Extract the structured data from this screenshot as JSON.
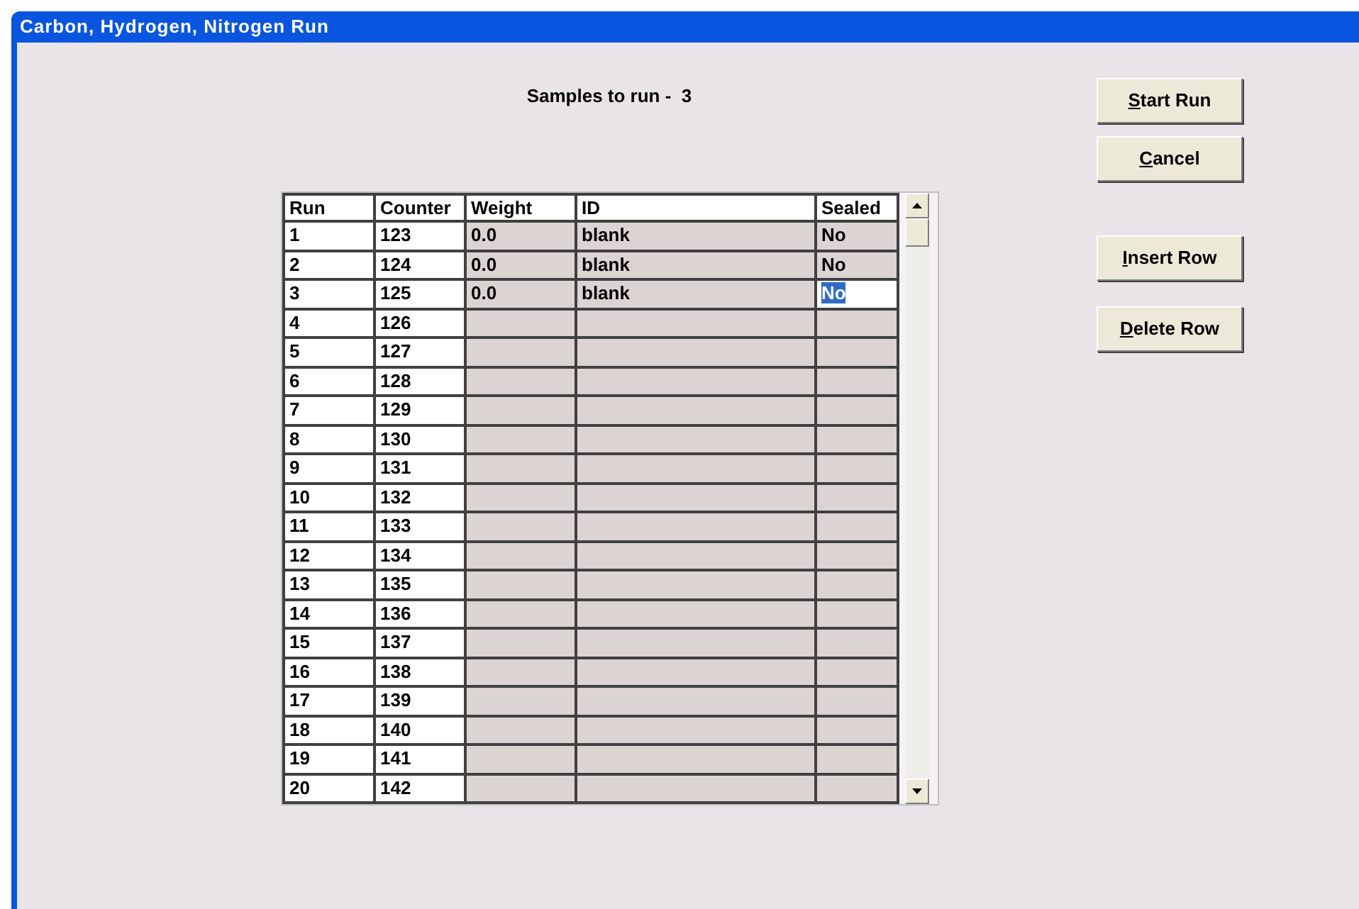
{
  "window": {
    "title": "Carbon, Hydrogen, Nitrogen Run"
  },
  "summary": "Samples to run -  3",
  "table": {
    "columns": [
      "Run",
      "Counter",
      "Weight",
      "ID",
      "Sealed"
    ],
    "rows": [
      {
        "run": "1",
        "counter": "123",
        "weight": "0.0",
        "id": "blank",
        "sealed": "No",
        "editing": false
      },
      {
        "run": "2",
        "counter": "124",
        "weight": "0.0",
        "id": "blank",
        "sealed": "No",
        "editing": false
      },
      {
        "run": "3",
        "counter": "125",
        "weight": "0.0",
        "id": "blank",
        "sealed": "No",
        "editing": true
      },
      {
        "run": "4",
        "counter": "126",
        "editing": false
      },
      {
        "run": "5",
        "counter": "127",
        "editing": false
      },
      {
        "run": "6",
        "counter": "128",
        "editing": false
      },
      {
        "run": "7",
        "counter": "129",
        "editing": false
      },
      {
        "run": "8",
        "counter": "130",
        "editing": false
      },
      {
        "run": "9",
        "counter": "131",
        "editing": false
      },
      {
        "run": "10",
        "counter": "132",
        "editing": false
      },
      {
        "run": "11",
        "counter": "133",
        "editing": false
      },
      {
        "run": "12",
        "counter": "134",
        "editing": false
      },
      {
        "run": "13",
        "counter": "135",
        "editing": false
      },
      {
        "run": "14",
        "counter": "136",
        "editing": false
      },
      {
        "run": "15",
        "counter": "137",
        "editing": false
      },
      {
        "run": "16",
        "counter": "138",
        "editing": false
      },
      {
        "run": "17",
        "counter": "139",
        "editing": false
      },
      {
        "run": "18",
        "counter": "140",
        "editing": false
      },
      {
        "run": "19",
        "counter": "141",
        "editing": false
      },
      {
        "run": "20",
        "counter": "142",
        "editing": false
      }
    ]
  },
  "buttons": [
    {
      "accelerator": "S",
      "rest": "tart Run",
      "kind": "top"
    },
    {
      "accelerator": "C",
      "rest": "ancel",
      "kind": "top"
    },
    {
      "accelerator": "I",
      "rest": "nsert Row",
      "kind": "row"
    },
    {
      "accelerator": "D",
      "rest": "elete Row",
      "kind": "row"
    }
  ]
}
